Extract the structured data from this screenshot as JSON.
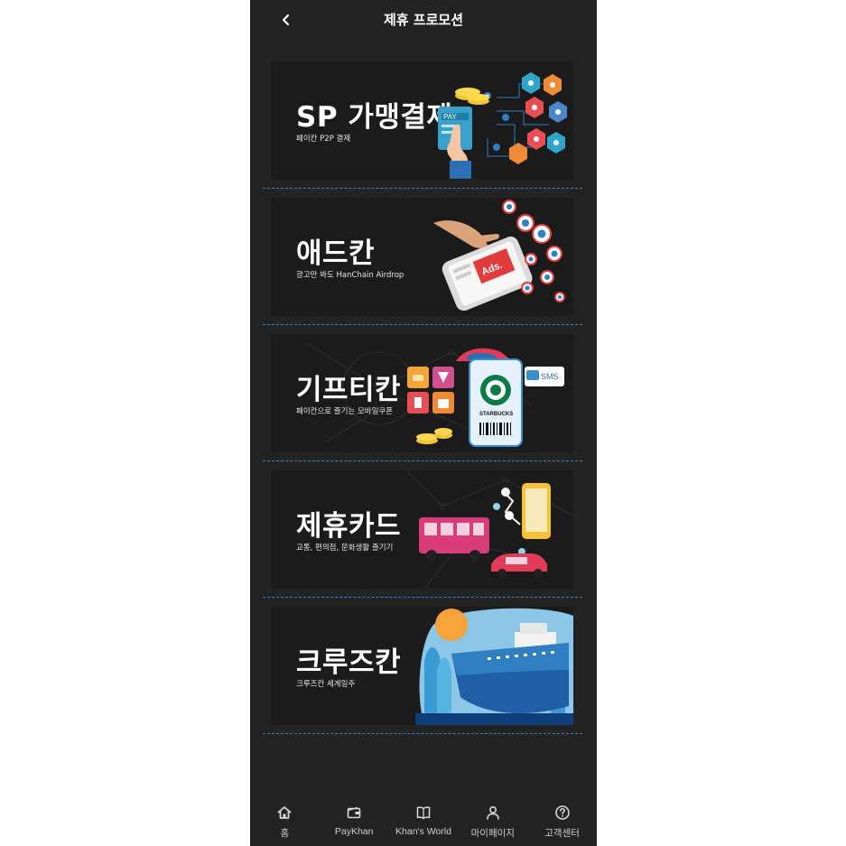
{
  "header": {
    "title": "제휴 프로모션",
    "back_icon": "chevron-left-icon"
  },
  "banners": [
    {
      "title": "SP 가맹결제",
      "subtitle": "페이칸 P2P 결제",
      "art_text": "PAY"
    },
    {
      "title": "애드칸",
      "subtitle": "광고만 봐도 HanChain Airdrop",
      "art_text": "Ads."
    },
    {
      "title": "기프티칸",
      "subtitle": "페이칸으로 즐기는 모바일쿠폰",
      "art_text": "STARBUCKS",
      "art_badge": "SMS"
    },
    {
      "title": "제휴카드",
      "subtitle": "교통, 편의점, 문화생활 즐기기"
    },
    {
      "title": "크루즈칸",
      "subtitle": "크루즈칸 세계일주"
    }
  ],
  "bottom_nav": [
    {
      "label": "홈",
      "icon": "home-icon"
    },
    {
      "label": "PayKhan",
      "icon": "wallet-icon"
    },
    {
      "label": "Khan's World",
      "icon": "book-icon"
    },
    {
      "label": "마이페이지",
      "icon": "person-icon"
    },
    {
      "label": "고객센터",
      "icon": "help-circle-icon"
    }
  ],
  "colors": {
    "background": "#232323",
    "banner_bg": "#1b1b1b",
    "divider": "#3f7fc0",
    "text": "#ffffff"
  }
}
